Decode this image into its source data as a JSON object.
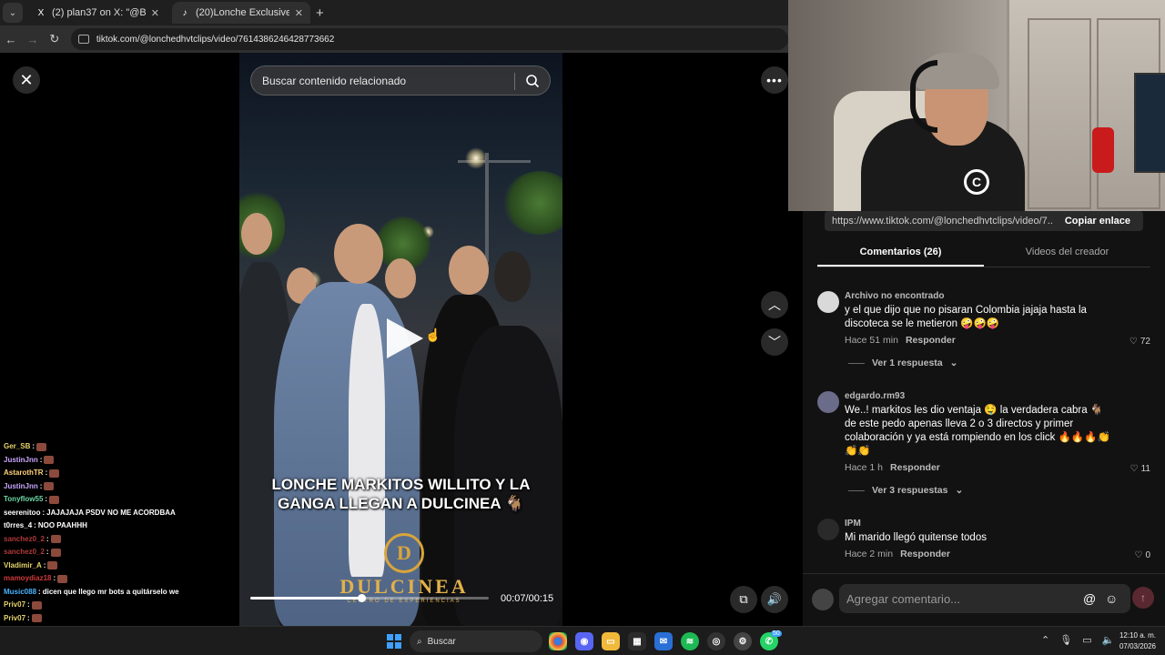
{
  "browser": {
    "tabs": [
      {
        "label": "(2) plan37 on X: \"@BadEndingT",
        "favicon": "X",
        "active": false
      },
      {
        "label": "(20)Lonche Exclusive (@lonche",
        "favicon": "♪",
        "active": true
      }
    ],
    "new_tab_label": "+",
    "url": "tiktok.com/@lonchedhvtclips/video/7614386246428773662"
  },
  "viewer": {
    "search_placeholder": "Buscar contenido relacionado",
    "caption": "LONCHE MARKITOS WILLITO Y LA GANGA LLEGAN A DULCINEA 🐐",
    "logo_letter": "D",
    "logo_name": "DULCINEA",
    "logo_sub": "CENTRO DE EXPERIENCIAS",
    "time": "00:07/00:15",
    "progress_fraction": 0.467
  },
  "chat": [
    {
      "user": "Ger_SB",
      "color": "#e6d36b",
      "msg": ""
    },
    {
      "user": "JustinJnn",
      "color": "#c9a6ff",
      "msg": ""
    },
    {
      "user": "AstarothTR",
      "color": "#ffd27a",
      "msg": ""
    },
    {
      "user": "JustinJnn",
      "color": "#c9a6ff",
      "msg": ""
    },
    {
      "user": "Tonyflow55",
      "color": "#6bd6a6",
      "msg": ""
    },
    {
      "user": "seerenitoo",
      "color": "#ffffff",
      "msg": "JAJAJAJA PSDV NO ME ACORDBAA"
    },
    {
      "user": "t0rres_4",
      "color": "#ffffff",
      "msg": "NOO PAAHHH"
    },
    {
      "user": "sanchez0_2",
      "color": "#b03a3a",
      "msg": ""
    },
    {
      "user": "sanchez0_2",
      "color": "#b03a3a",
      "msg": ""
    },
    {
      "user": "Vladimir_A",
      "color": "#e6d36b",
      "msg": ""
    },
    {
      "user": "mamoydiaz18",
      "color": "#d13a3a",
      "msg": ""
    },
    {
      "user": "Music088",
      "color": "#4ab3ff",
      "msg": "dicen que llego mr bots a quitárselo we"
    },
    {
      "user": "Priv07",
      "color": "#e6d36b",
      "msg": ""
    },
    {
      "user": "Priv07",
      "color": "#e6d36b",
      "msg": ""
    },
    {
      "user": "Priv07",
      "color": "#e6d36b",
      "msg": ""
    },
    {
      "user": "mamoydiaz18",
      "color": "#d13a3a",
      "msg": ""
    }
  ],
  "panel": {
    "share_url": "https://www.tiktok.com/@lonchedhvtclips/video/7...",
    "copy_label": "Copiar enlace",
    "tab_comments": "Comentarios (26)",
    "tab_creator": "Videos del creador",
    "comments": [
      {
        "user": "Archivo no encontrado",
        "text": "y el que dijo que no pisaran Colombia jajaja hasta la discoteca se le metieron 🤪🤪🤪",
        "time": "Hace 51 min",
        "reply_label": "Responder",
        "likes": "72",
        "replies": "Ver 1 respuesta"
      },
      {
        "user": "edgardo.rm93",
        "text": "We..! markitos les dio ventaja 🤤 la verdadera cabra 🐐 de este pedo apenas lleva 2 o 3 directos y primer colaboración y ya está rompiendo en los click 🔥🔥🔥👏 👏👏",
        "time": "Hace 1 h",
        "reply_label": "Responder",
        "likes": "11",
        "replies": "Ver 3 respuestas"
      },
      {
        "user": "IPM",
        "text": "Mi marido llegó quitense todos",
        "time": "Hace 2 min",
        "reply_label": "Responder",
        "likes": "0",
        "replies": ""
      }
    ],
    "add_comment_placeholder": "Agregar comentario..."
  },
  "taskbar": {
    "search_label": "Buscar",
    "whatsapp_badge": "50",
    "time": "12:10 a. m.",
    "date": "07/03/2026"
  }
}
